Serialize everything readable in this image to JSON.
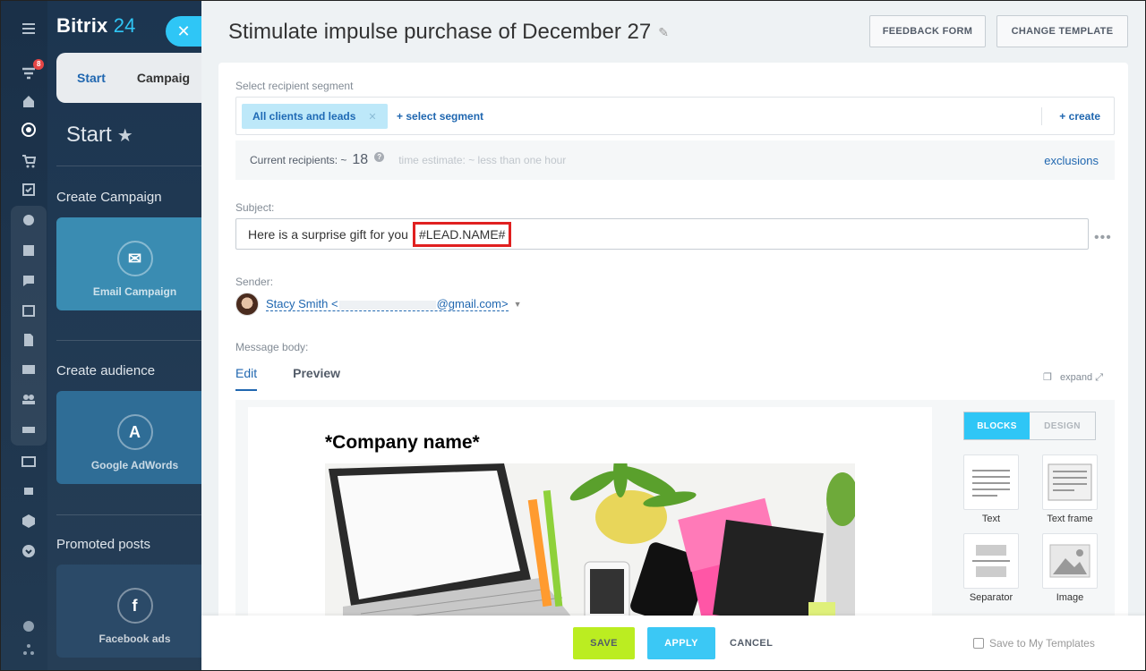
{
  "app": {
    "brand": "Bitrix",
    "brand_num": "24",
    "notif_count": "8"
  },
  "left_panel": {
    "tabs": [
      "Start",
      "Campaig"
    ],
    "title": "Start",
    "sections": [
      {
        "title": "Create Campaign",
        "tile": "Email Campaign"
      },
      {
        "title": "Create audience",
        "tile": "Google AdWords"
      },
      {
        "title": "Promoted posts",
        "tile": "Facebook ads"
      }
    ]
  },
  "header": {
    "title": "Stimulate impulse purchase of December 27",
    "feedback_btn": "FEEDBACK FORM",
    "template_btn": "CHANGE TEMPLATE"
  },
  "segment": {
    "label": "Select recipient segment",
    "chip": "All clients and leads",
    "select_link": "+ select segment",
    "create_link": "+ create"
  },
  "recipients": {
    "label": "Current recipients: ~",
    "count": "18",
    "estimate": "time estimate: ~ less than one hour",
    "exclusions": "exclusions"
  },
  "subject": {
    "label": "Subject:",
    "text": "Here is a surprise gift for you",
    "token": "#LEAD.NAME#"
  },
  "sender": {
    "label": "Sender:",
    "name": "Stacy Smith <",
    "email_suffix": "@gmail.com>"
  },
  "message": {
    "label": "Message body:",
    "tab_edit": "Edit",
    "tab_preview": "Preview",
    "expand": "expand",
    "company_name": "*Company name*"
  },
  "blocks_panel": {
    "tab_blocks": "BLOCKS",
    "tab_design": "DESIGN",
    "items": [
      "Text",
      "Text frame",
      "Separator",
      "Image"
    ]
  },
  "footer": {
    "save": "SAVE",
    "apply": "APPLY",
    "cancel": "CANCEL",
    "save_tpl": "Save to My Templates"
  },
  "colors": {
    "accent": "#2fc6f6",
    "link": "#2067b0",
    "save": "#bbed21",
    "highlight": "#e02020"
  }
}
